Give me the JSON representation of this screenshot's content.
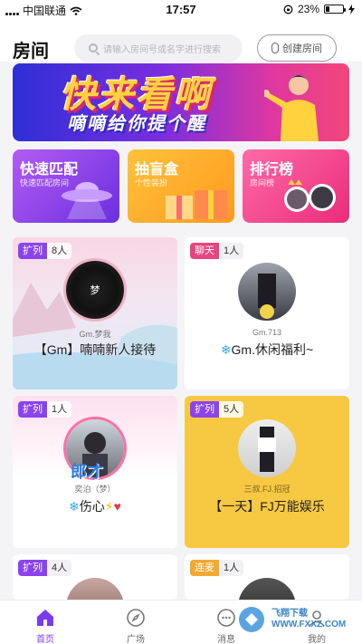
{
  "status_bar": {
    "carrier": "中国联通",
    "time": "17:57",
    "battery": "23%"
  },
  "header": {
    "title": "房间",
    "search_placeholder": "请输入房间号或名字进行搜索",
    "create_button": "创建房间"
  },
  "banner": {
    "line1": "快来看啊",
    "line2": "嘀嘀给你提个醒"
  },
  "quick_entries": [
    {
      "title": "快速匹配",
      "subtitle": "快速匹配房间",
      "color": "#8a3ff0"
    },
    {
      "title": "抽盲盒",
      "subtitle": "个性装扮",
      "color": "#ffb12d"
    },
    {
      "title": "排行榜",
      "subtitle": "房间榜",
      "color": "#f0408a"
    }
  ],
  "rooms": [
    {
      "kind": "扩列",
      "count": "8人",
      "owner": "Gm.梦我",
      "title": "【Gm】喃喃新人接待",
      "disc_text": "梦"
    },
    {
      "kind": "聊天",
      "count": "1人",
      "owner": "Gm.713",
      "title": "Gm.休闲福利~"
    },
    {
      "kind": "扩列",
      "count": "1人",
      "owner": "奕泊（梦）",
      "title": "伤心",
      "badge": "郎才"
    },
    {
      "kind": "扩列",
      "count": "5人",
      "owner": "三叔.FJ.招冠",
      "title": "【一天】FJ万能娱乐"
    },
    {
      "kind": "扩列",
      "count": "4人"
    },
    {
      "kind": "连麦",
      "count": "1人"
    }
  ],
  "tabbar": [
    {
      "label": "首页",
      "active": true
    },
    {
      "label": "广场",
      "active": false
    },
    {
      "label": "消息",
      "active": false
    },
    {
      "label": "我的",
      "active": false
    }
  ],
  "watermark": "飞翔下载 WWW.FXXZ.COM",
  "colors": {
    "accent": "#7b3af0",
    "tag_purple": "#8b43f0",
    "tag_pink": "#e9447f",
    "tag_orange": "#f4a92f"
  }
}
